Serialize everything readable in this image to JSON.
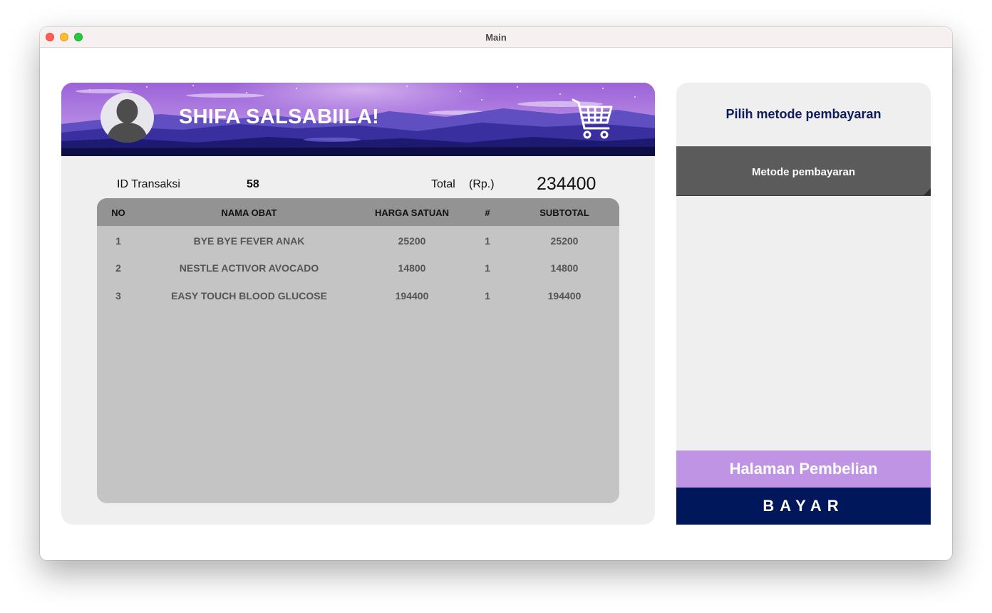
{
  "window": {
    "title": "Main"
  },
  "header": {
    "greeting": "SHIFA SALSABIILA!"
  },
  "transaction": {
    "id_label": "ID Transaksi",
    "id_value": "58",
    "total_label": "Total",
    "currency_label": "(Rp.)",
    "total_value": "234400"
  },
  "table": {
    "columns": [
      "NO",
      "NAMA OBAT",
      "HARGA SATUAN",
      "#",
      "SUBTOTAL"
    ],
    "rows": [
      [
        "1",
        "BYE BYE FEVER ANAK",
        "25200",
        "1",
        "25200"
      ],
      [
        "2",
        "NESTLE ACTIVOR AVOCADO",
        "14800",
        "1",
        "14800"
      ],
      [
        "3",
        "EASY TOUCH BLOOD GLUCOSE",
        "194400",
        "1",
        "194400"
      ]
    ]
  },
  "payment": {
    "heading": "Pilih metode pembayaran",
    "method_placeholder": "Metode pembayaran",
    "purchase_page_button": "Halaman Pembelian",
    "pay_button": "BAYAR"
  },
  "icons": {
    "avatar": "user-silhouette-icon",
    "cart": "shopping-cart-icon"
  },
  "colors": {
    "banner": "#9b6ad6",
    "table_header": "#939393",
    "table_body": "#c4c4c4",
    "heading_text": "#0d1a5c",
    "method_select": "#5b5b5b",
    "purchase_button": "#bf94e4",
    "pay_button": "#00175c"
  }
}
